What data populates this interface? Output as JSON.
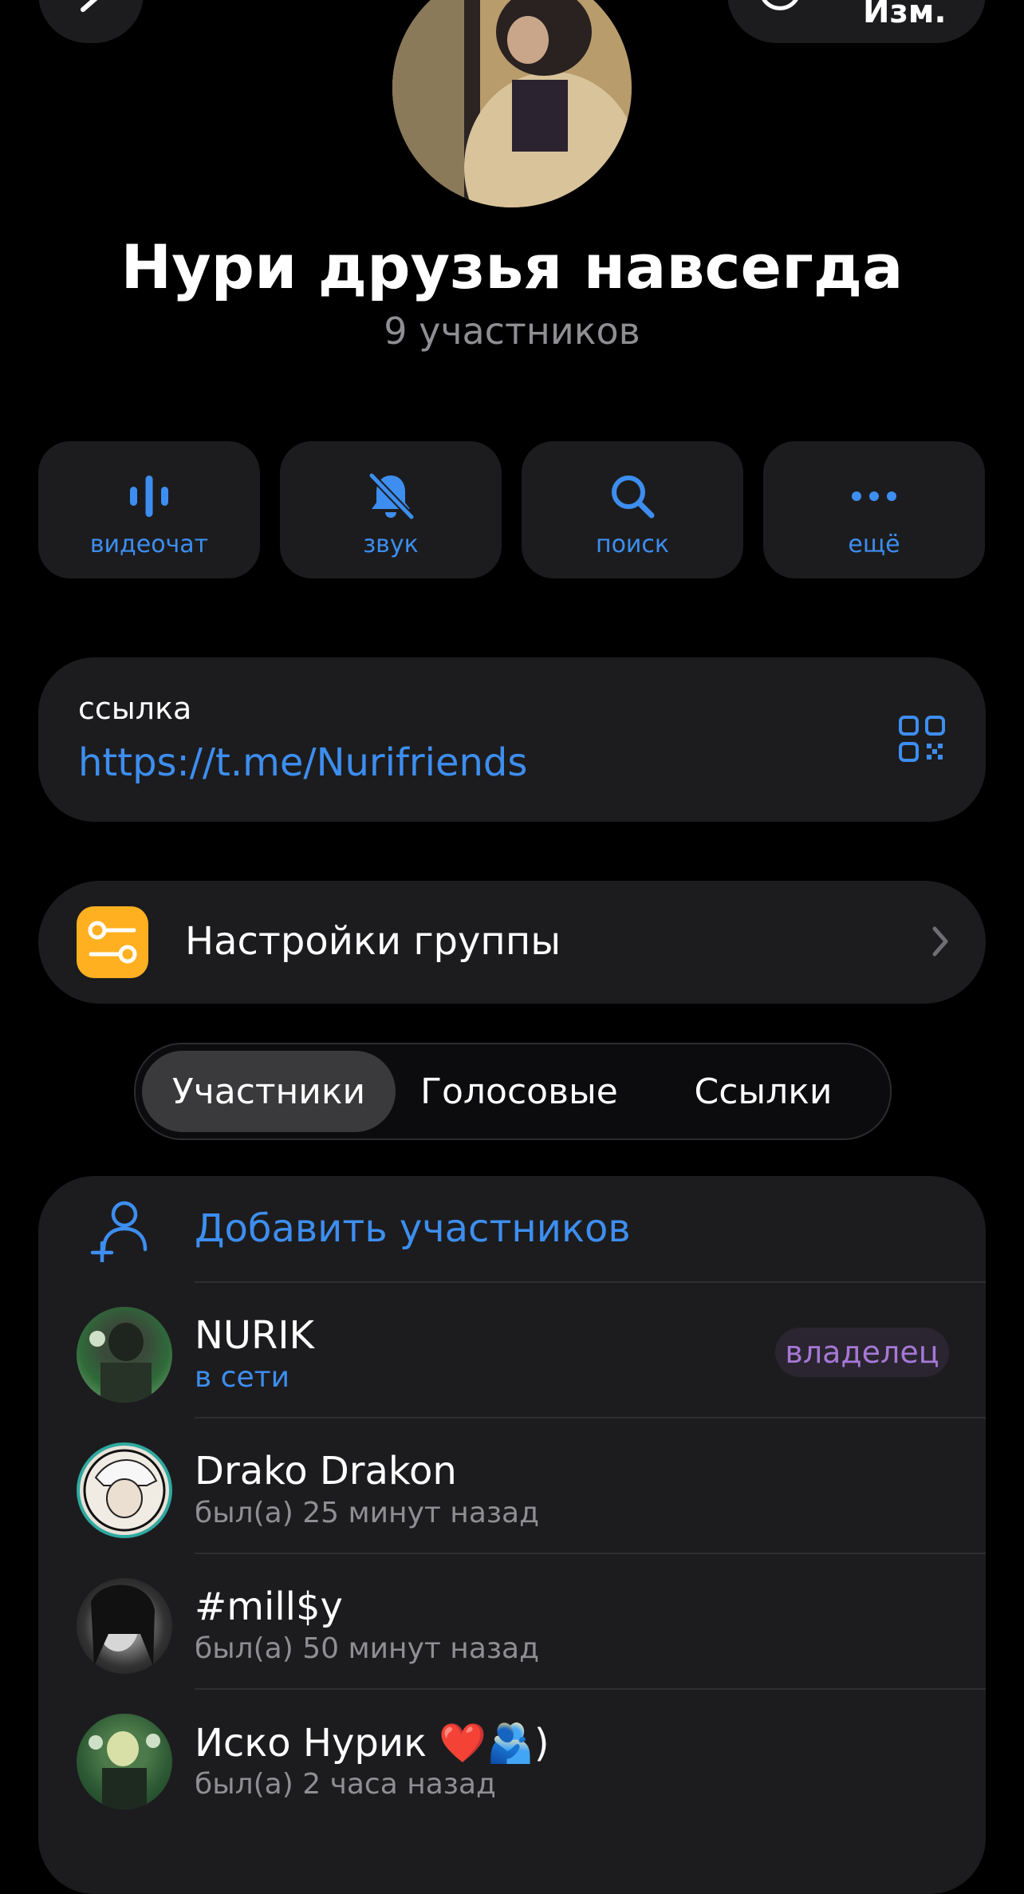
{
  "header": {
    "edit_label": "Изм."
  },
  "group": {
    "title": "Нури друзья навсегда",
    "subtitle": "9 участников"
  },
  "actions": [
    {
      "label": "видеочат",
      "icon": "voice-chat-icon"
    },
    {
      "label": "звук",
      "icon": "bell-slash-icon"
    },
    {
      "label": "поиск",
      "icon": "search-icon"
    },
    {
      "label": "ещё",
      "icon": "more-icon"
    }
  ],
  "link": {
    "caption": "ссылка",
    "url": "https://t.me/Nurifriends",
    "icon": "qr-code-icon"
  },
  "settings": {
    "label": "Настройки группы",
    "icon": "sliders-icon"
  },
  "tabs": [
    {
      "label": "Участники",
      "active": true
    },
    {
      "label": "Голосовые",
      "active": false
    },
    {
      "label": "Ссылки",
      "active": false
    }
  ],
  "members": {
    "add_label": "Добавить участников",
    "list": [
      {
        "name": "NURIK",
        "status": "в сети",
        "online": true,
        "badge": "владелец"
      },
      {
        "name": "Drako Drakon",
        "status": "был(а) 25 минут назад",
        "online": false
      },
      {
        "name": "#mill$y",
        "status": "был(а) 50 минут назад",
        "online": false
      },
      {
        "name": "Иско Нурик ❤️🫂)",
        "status": "был(а) 2 часа назад",
        "online": false
      }
    ]
  },
  "colors": {
    "accent": "#3d8ef0",
    "background": "#000000",
    "card": "#1c1c1e",
    "owner_badge": "#a678d6",
    "settings_icon_bg": "#ffb020"
  }
}
